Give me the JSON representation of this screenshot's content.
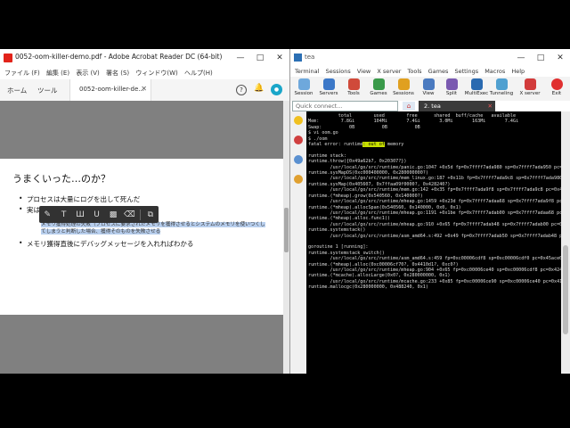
{
  "acrobat": {
    "title": "0052-oom-killer-demo.pdf - Adobe Acrobat Reader DC (64-bit)",
    "menu": [
      "ファイル (F)",
      "編集 (E)",
      "表示 (V)",
      "署名 (S)",
      "ウィンドウ(W)",
      "ヘルプ(H)"
    ],
    "tab_home": "ホーム",
    "tab_tools": "ツール",
    "tab_doc": "0052-oom-killer-de...",
    "heading": "うまくいった…のか？",
    "bullet1": "プロセスは大量にログを出して死んだ",
    "bullet2": "実は",
    "sub_text": "メモリ獲得処理の失敗（プロセスに要求されたメモリを獲得させるとシステムのメモリを使いつくしてしまうと判断した場合、獲得そのものを失敗させる",
    "bullet3": "メモリ獲得直後にデバッグメッセージを入れればわかる"
  },
  "terminal": {
    "title": "tea",
    "menu": [
      "Terminal",
      "Sessions",
      "View",
      "X server",
      "Tools",
      "Games",
      "Settings",
      "Macros",
      "Help"
    ],
    "tools": [
      "Session",
      "Servers",
      "Tools",
      "Games",
      "Sessions",
      "View",
      "Split",
      "MultiExec",
      "Tunneling",
      "X server",
      "Exit"
    ],
    "quick_connect": "Quick connect...",
    "tab_label": "2. tea",
    "console_lines": [
      "           total        used        free      shared  buff/cache   available",
      "Mem:        7.8Gi       104Mi       7.4Gi       3.0Mi       163Mi       7.4Gi",
      "Swap:          0B          0B          0B",
      "$ vi oom.go",
      "$ ./oom",
      "runtime stack:",
      "runtime.throw({0x49a62b7, 0x20307?})",
      "        /usr/local/go/src/runtime/panic.go:1047 +0x5d fp=0x7ffff7ada980 sp=0x7ffff7ada950 pc=0x43177d",
      "runtime.sysMapOS(0xc000400000, 0x280000000?)",
      "        /usr/local/go/src/runtime/mem_linux.go:187 +0x11b fp=0x7ffff7ada9c8 sp=0x7ffff7ada980 pc=0x414ffb",
      "runtime.sysMap(0x405607, 0x7ffaa09f0000?, 0x428240?)",
      "        /usr/local/go/src/runtime/mem.go:142 +0x35 fp=0x7ffff7ada9f8 sp=0x7ffff7ada9c8 pc=0x4149d5",
      "runtime.(*mheap).grow(0x540560, 0x140000?)",
      "        /usr/local/go/src/runtime/mheap.go:1459 +0x23d fp=0x7ffff7adaa68 sp=0x7ffff7ada9f8 pc=0x4252fd",
      "runtime.(*mheap).allocSpan(0x540560, 0x140000, 0x0, 0x1)",
      "        /usr/local/go/src/runtime/mheap.go:1191 +0x1be fp=0x7ffff7adab00 sp=0x7ffff7adaa68 pc=0x424a5e",
      "runtime.(*mheap).alloc.func1()",
      "        /usr/local/go/src/runtime/mheap.go:910 +0x65 fp=0x7ffff7adab48 sp=0x7ffff7adab00 pc=0x4244e5",
      "runtime.systemstack()",
      "        /usr/local/go/src/runtime/asm_amd64.s:492 +0x49 fp=0x7ffff7adab50 sp=0x7ffff7adab48 pc=0x45ad49",
      "",
      "goroutine 1 [running]:",
      "runtime.systemstack_switch()",
      "        /usr/local/go/src/runtime/asm_amd64.s:459 fp=0xc00006cdf8 sp=0xc00006cdf0 pc=0x45ace0",
      "runtime.(*mheap).alloc(0xc00006cf70?, 0x4410d1?, 0xc0?)",
      "        /usr/local/go/src/runtime/mheap.go:904 +0x65 fp=0xc00006ce40 sp=0xc00006cdf8 pc=0x424425",
      "runtime.(*mcache).allocLarge(0x0?, 0x280000000, 0x1)",
      "        /usr/local/go/src/runtime/mcache.go:233 +0x85 fp=0xc00006ce90 sp=0xc00006ce40 pc=0x413965",
      "runtime.mallocgc(0x280000000, 0x488240, 0x1)"
    ],
    "fatal_prefix": "fatal error: runtime",
    "fatal_hl": ": out of",
    "fatal_suffix": " memory"
  }
}
